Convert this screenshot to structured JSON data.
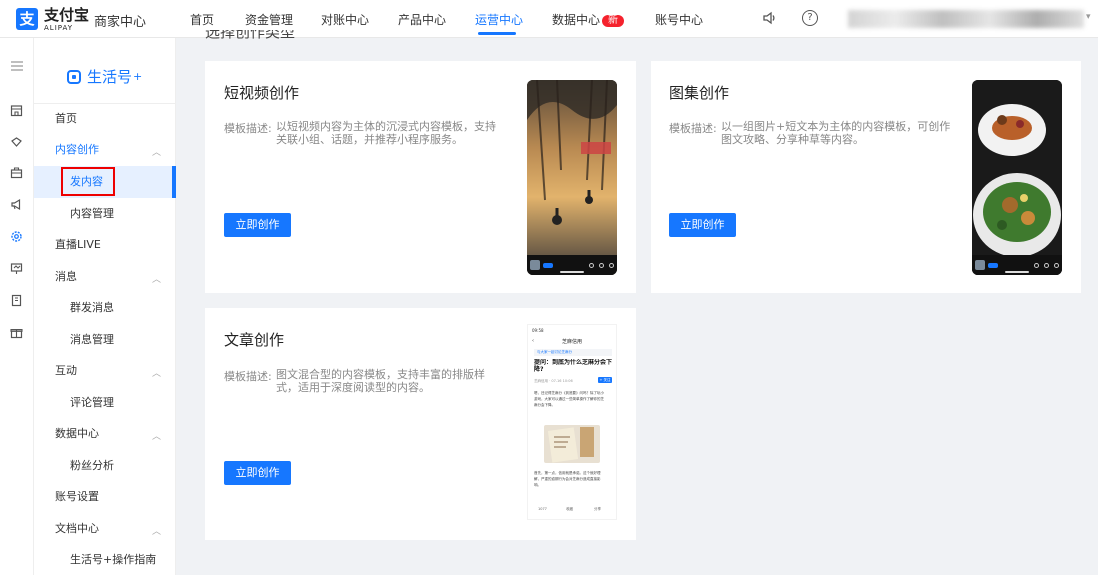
{
  "header": {
    "logo_char": "支",
    "brand": "支付宝",
    "brand_sub": "ALIPAY",
    "merchant_center": "商家中心",
    "nav": [
      {
        "label": "首页"
      },
      {
        "label": "资金管理"
      },
      {
        "label": "对账中心"
      },
      {
        "label": "产品中心"
      },
      {
        "label": "运营中心",
        "active": true
      },
      {
        "label": "数据中心",
        "badge": "新"
      },
      {
        "label": "账号中心"
      }
    ],
    "help_icon_text": "?"
  },
  "rail": {
    "icons": [
      "menu-icon",
      "store-icon",
      "diamond-icon",
      "briefcase-icon",
      "megaphone-icon",
      "gear-flower-icon",
      "presentation-icon",
      "card-icon",
      "gift-icon"
    ]
  },
  "sidebar": {
    "product_name": "生活号",
    "product_sup": "+",
    "items": [
      {
        "label": "首页",
        "level": 1
      },
      {
        "label": "内容创作",
        "level": 1,
        "expanded": true,
        "active_parent": true
      },
      {
        "label": "发内容",
        "level": 2,
        "active": true
      },
      {
        "label": "内容管理",
        "level": 2
      },
      {
        "label": "直播LIVE",
        "level": 1
      },
      {
        "label": "消息",
        "level": 1,
        "expanded": true
      },
      {
        "label": "群发消息",
        "level": 2
      },
      {
        "label": "消息管理",
        "level": 2
      },
      {
        "label": "互动",
        "level": 1,
        "expanded": true
      },
      {
        "label": "评论管理",
        "level": 2
      },
      {
        "label": "数据中心",
        "level": 1,
        "expanded": true
      },
      {
        "label": "粉丝分析",
        "level": 2
      },
      {
        "label": "账号设置",
        "level": 1
      },
      {
        "label": "文档中心",
        "level": 1,
        "expanded": true
      },
      {
        "label": "生活号+操作指南",
        "level": 2
      }
    ]
  },
  "main": {
    "section_heading_fragment": "选择创作类型",
    "desc_label": "模板描述:",
    "cards": [
      {
        "title": "短视频创作",
        "desc": "以短视频内容为主体的沉浸式内容模板，支持关联小组、话题，并推荐小程序服务。",
        "button": "立即创作"
      },
      {
        "title": "图集创作",
        "desc": "以一组图片+短文本为主体的内容模板，可创作图文攻略、分享种草等内容。",
        "button": "立即创作"
      },
      {
        "title": "文章创作",
        "desc": "图文混合型的内容模板，支持丰富的排版样式，适用于深度阅读型的内容。",
        "button": "立即创作"
      }
    ],
    "article_preview": {
      "status_time": "09:58",
      "nav_title": "芝麻信用",
      "tag": "与大家一起讨论芝麻分",
      "headline": "提问：到底为什么芝麻分会下降?",
      "meta": "芝麻信用 · 07-16 10:06",
      "follow": "+ 关注",
      "para1": "嗯，还记得芝麻分《到底要》问吗？除了玩小游戏，大家可以通过一些简单操作了解你的芝麻分会下降。",
      "para2": "首先，第一点，信用就是承诺。这个就好理解，严重的逾期行为会对芝麻分造成直接影响。",
      "actions": [
        "1077",
        "收藏",
        "分享"
      ]
    }
  }
}
